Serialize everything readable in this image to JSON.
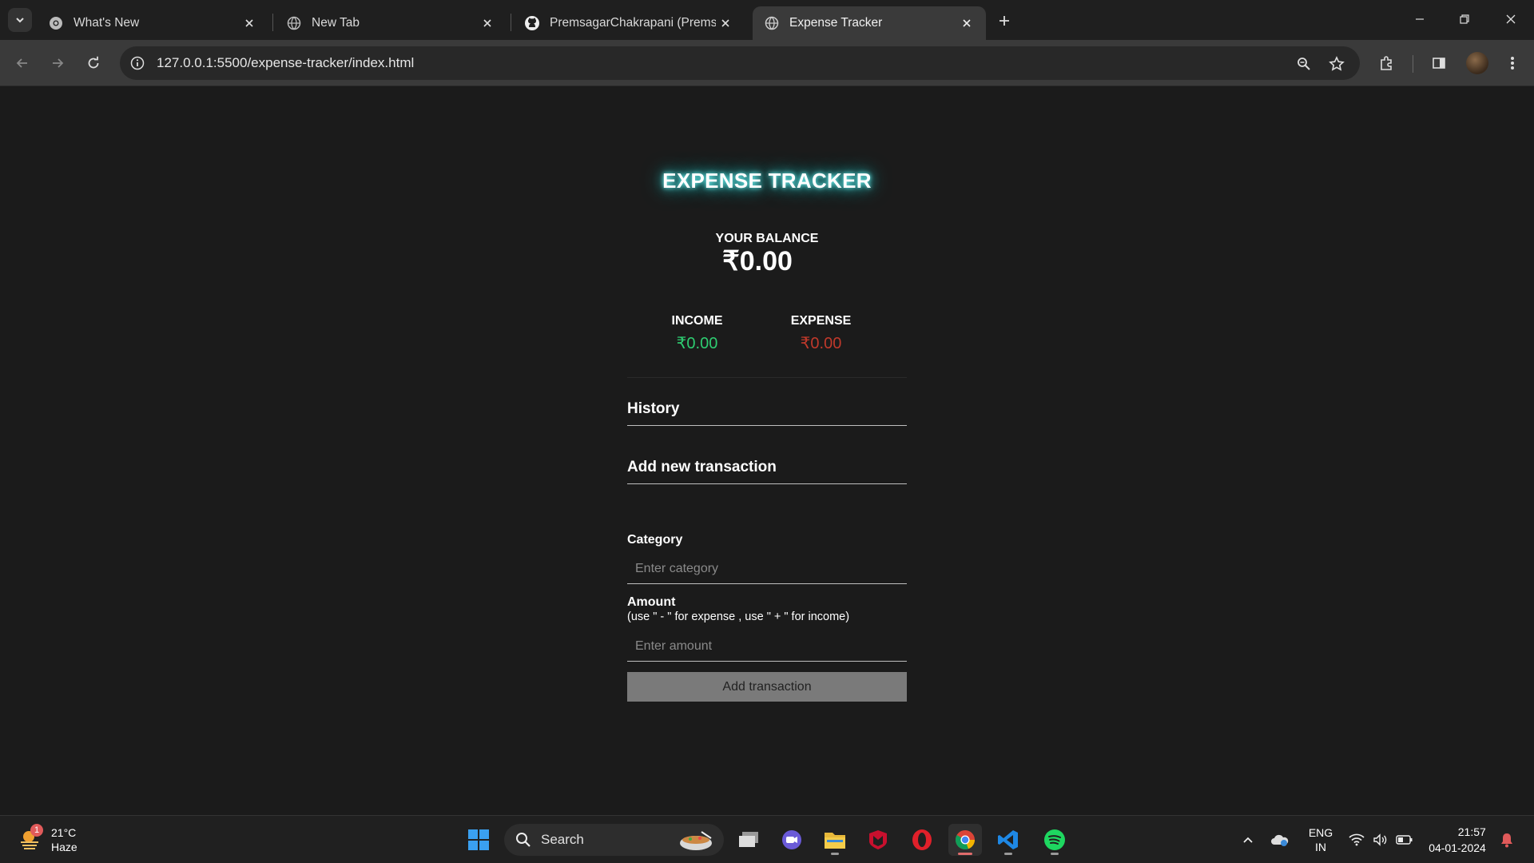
{
  "browser": {
    "tabs": [
      {
        "title": "What's New",
        "icon": "chrome-icon",
        "active": false
      },
      {
        "title": "New Tab",
        "icon": "globe-icon",
        "active": false
      },
      {
        "title": "PremsagarChakrapani (Premsag",
        "icon": "github-icon",
        "active": false
      },
      {
        "title": "Expense Tracker",
        "icon": "globe-icon",
        "active": true
      }
    ],
    "url": "127.0.0.1:5500/expense-tracker/index.html"
  },
  "app": {
    "title": "EXPENSE TRACKER",
    "balance_label": "YOUR BALANCE",
    "balance_value": "₹0.00",
    "income_label": "INCOME",
    "income_value": "₹0.00",
    "expense_label": "EXPENSE",
    "expense_value": "₹0.00",
    "history_heading": "History",
    "add_heading": "Add new transaction",
    "category_label": "Category",
    "category_placeholder": "Enter category",
    "amount_label": "Amount",
    "amount_hint": "(use \" - \" for expense , use \" + \" for income)",
    "amount_placeholder": "Enter amount",
    "submit_label": "Add transaction",
    "colors": {
      "income": "#2ecc71",
      "expense": "#c0392b",
      "glow": "#33cccc"
    }
  },
  "taskbar": {
    "weather": {
      "temp": "21°C",
      "condition": "Haze",
      "badge": "1"
    },
    "search_label": "Search",
    "language": {
      "line1": "ENG",
      "line2": "IN"
    },
    "clock": {
      "time": "21:57",
      "date": "04-01-2024"
    }
  }
}
